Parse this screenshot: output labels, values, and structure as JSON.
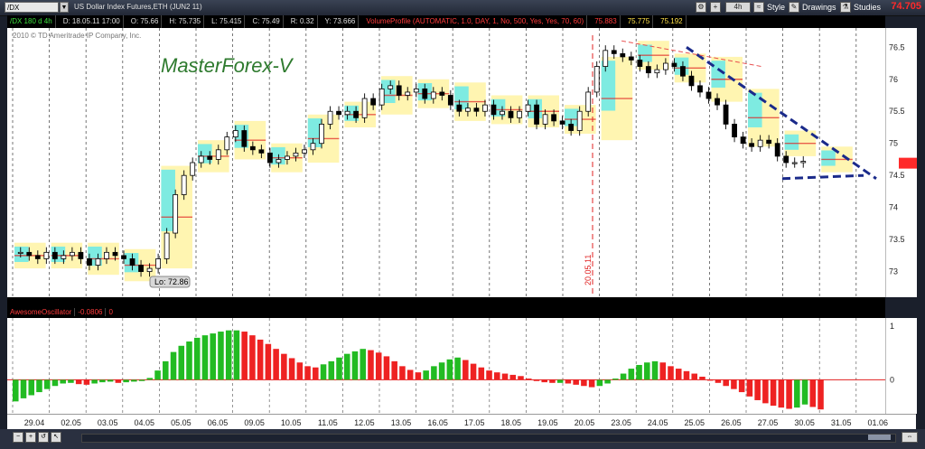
{
  "toolbar": {
    "symbol": "/DX",
    "description": "US Dollar Index Futures,ETH (JUN2 11)",
    "timeframe": "4h",
    "style_label": "Style",
    "drawings_label": "Drawings",
    "studies_label": "Studies",
    "last_price": "74.705"
  },
  "info": {
    "symbol_tf": "/DX 180 d 4h",
    "date": "D: 18.05.11 17:00",
    "open": "O: 75.66",
    "high": "H: 75.735",
    "low": "L: 75.415",
    "close": "C: 75.49",
    "range": "R: 0.32",
    "y": "Y: 73.666",
    "study": "VolumeProfile (AUTOMATIC, 1.0, DAY, 1, No, 500, Yes, Yes, 70, 60)",
    "val1": "75.883",
    "val2": "75.775",
    "val3": "75.192"
  },
  "copyright": "2010 © TD Ameritrade IP Company, Inc.",
  "watermark": "MasterForex-V",
  "low_label": "Lo: 72.86",
  "vline_date": "20.05.11",
  "oscillator": {
    "name": "AwesomeOscillator",
    "value": "-0.0806",
    "extra": "0",
    "ticks": [
      "1",
      "0"
    ]
  },
  "colors": {
    "up_bar": "#22bb22",
    "down_bar": "#ee2222",
    "profile_cyan": "#5ee8ee",
    "profile_yellow": "#fff4a8",
    "trendline": "#1a2a8a",
    "accent_red": "#ff2a2a"
  },
  "chart_data": [
    {
      "type": "candlestick",
      "title": "",
      "x_tick_labels": [
        "29.04",
        "02.05",
        "03.05",
        "04.05",
        "05.05",
        "06.05",
        "09.05",
        "10.05",
        "11.05",
        "12.05",
        "13.05",
        "16.05",
        "17.05",
        "18.05",
        "19.05",
        "20.05",
        "23.05",
        "24.05",
        "25.05",
        "26.05",
        "27.05",
        "30.05",
        "31.05",
        "01.06"
      ],
      "y_ticks": [
        "75.5",
        "75",
        "74.5",
        "74",
        "73.5",
        "73"
      ],
      "y_ticks_top": "75.5",
      "ylim": [
        72.6,
        76.8
      ],
      "close_path": [
        73.3,
        73.25,
        73.2,
        73.3,
        73.2,
        73.25,
        73.3,
        73.2,
        73.1,
        73.2,
        73.3,
        73.25,
        73.2,
        73.1,
        73.0,
        73.05,
        73.2,
        73.6,
        74.2,
        74.5,
        74.7,
        74.8,
        74.75,
        74.9,
        75.1,
        75.2,
        74.95,
        74.9,
        74.85,
        74.7,
        74.75,
        74.8,
        74.85,
        74.9,
        75.0,
        75.3,
        75.5,
        75.45,
        75.5,
        75.4,
        75.7,
        75.6,
        75.85,
        75.9,
        75.75,
        75.8,
        75.85,
        75.7,
        75.8,
        75.75,
        75.6,
        75.5,
        75.55,
        75.5,
        75.6,
        75.45,
        75.5,
        75.4,
        75.5,
        75.6,
        75.3,
        75.45,
        75.35,
        75.3,
        75.2,
        75.5,
        75.8,
        76.2,
        76.45,
        76.4,
        76.35,
        76.3,
        76.2,
        76.1,
        76.15,
        76.25,
        76.2,
        76.05,
        75.9,
        75.8,
        75.7,
        75.6,
        75.3,
        75.1,
        75.0,
        74.95,
        75.05,
        75.0,
        74.8,
        74.7,
        74.7,
        74.72
      ]
    },
    {
      "type": "bar",
      "title": "",
      "series": [
        {
          "values": [
            -0.35,
            -0.3,
            -0.25,
            -0.2,
            -0.15,
            -0.1,
            -0.06,
            -0.05,
            -0.07,
            -0.08,
            -0.06,
            -0.04,
            -0.03,
            -0.05,
            -0.04,
            -0.03,
            -0.02,
            0.03,
            0.15,
            0.3,
            0.45,
            0.55,
            0.62,
            0.68,
            0.72,
            0.75,
            0.78,
            0.8,
            0.8,
            0.78,
            0.72,
            0.65,
            0.58,
            0.5,
            0.42,
            0.35,
            0.28,
            0.22,
            0.2,
            0.25,
            0.3,
            0.36,
            0.42,
            0.46,
            0.5,
            0.48,
            0.44,
            0.38,
            0.3,
            0.22,
            0.16,
            0.12,
            0.15,
            0.22,
            0.28,
            0.33,
            0.36,
            0.32,
            0.26,
            0.2,
            0.15,
            0.12,
            0.1,
            0.08,
            0.06,
            0.02,
            -0.02,
            -0.04,
            -0.05,
            -0.05,
            -0.06,
            -0.08,
            -0.1,
            -0.12,
            -0.1,
            -0.06,
            0.02,
            0.1,
            0.18,
            0.24,
            0.28,
            0.3,
            0.28,
            0.22,
            0.18,
            0.14,
            0.1,
            0.05,
            0.0,
            -0.05,
            -0.1,
            -0.15,
            -0.2,
            -0.27,
            -0.33,
            -0.38,
            -0.42,
            -0.45,
            -0.47,
            -0.45,
            -0.4,
            -0.44,
            -0.48
          ]
        }
      ],
      "ylim": [
        -0.55,
        1.0
      ]
    }
  ]
}
